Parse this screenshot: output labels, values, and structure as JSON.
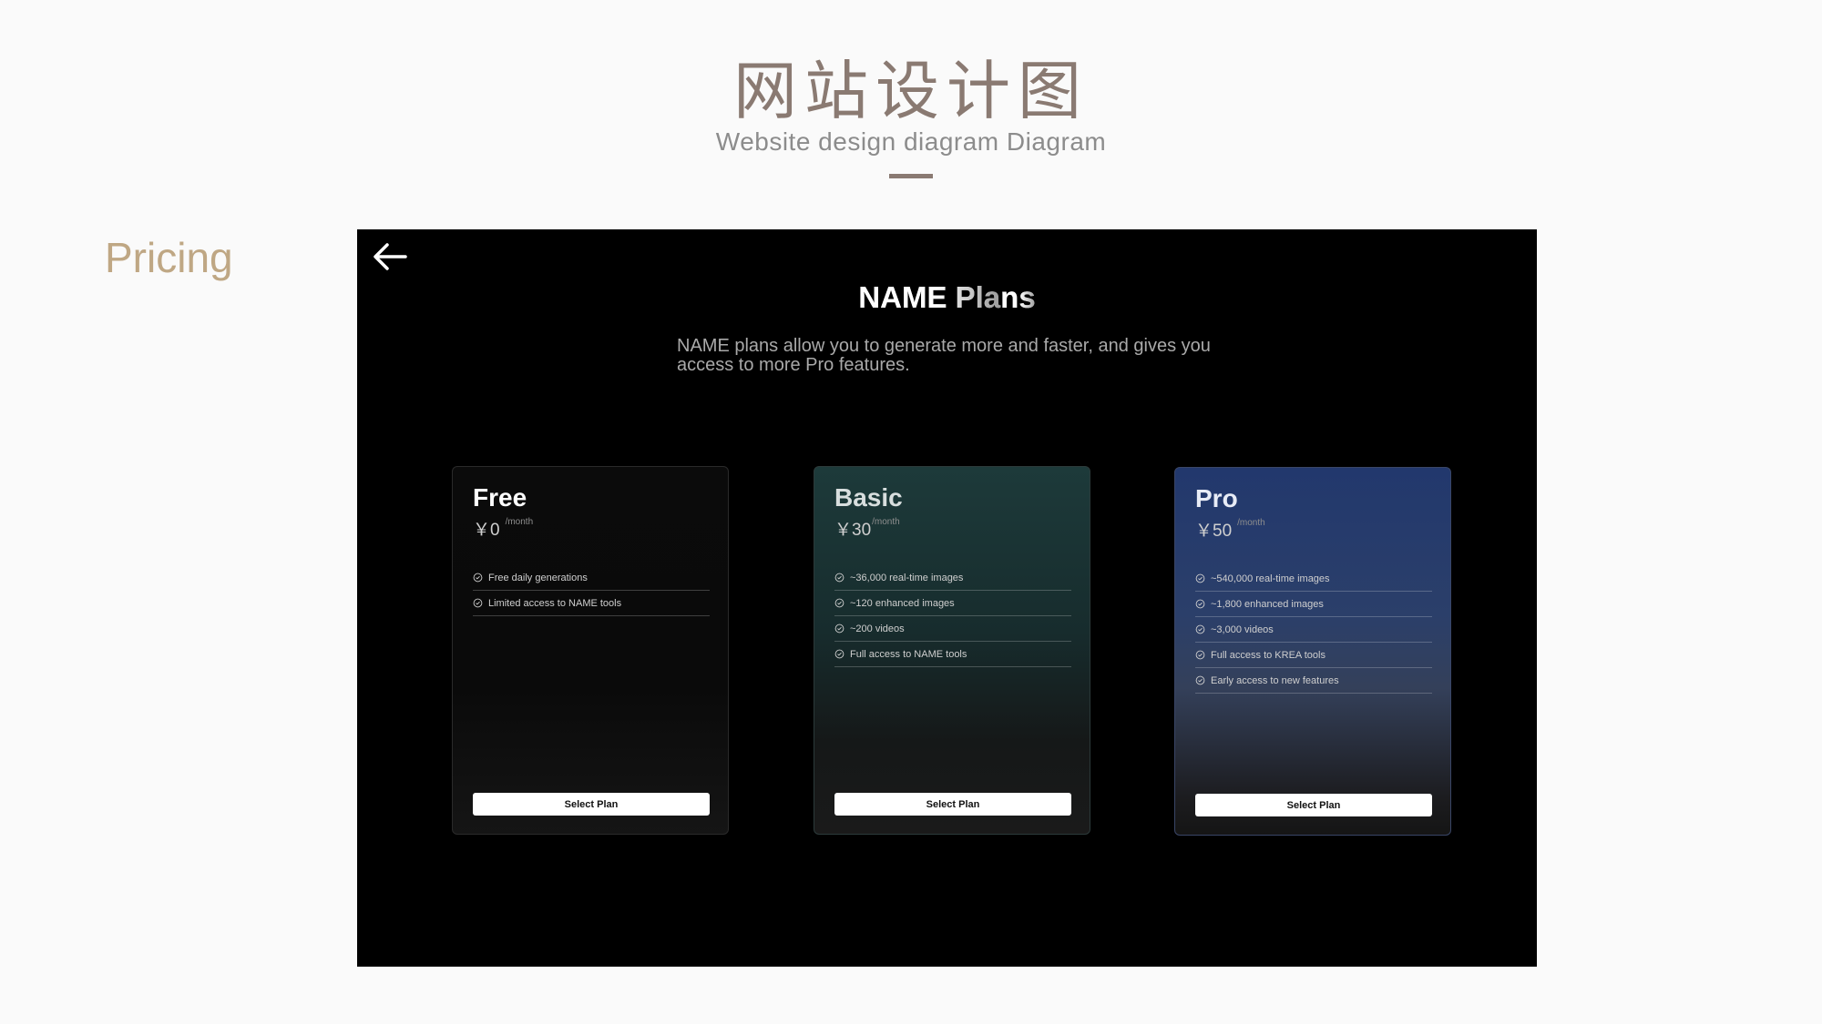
{
  "header": {
    "title": "网站设计图",
    "subtitle": "Website design diagram Diagram"
  },
  "section": {
    "label": "Pricing"
  },
  "screen": {
    "back_icon": "arrow-left-icon",
    "title_main": "NAME Pla",
    "title_fade": "ns",
    "description": "NAME plans allow you to generate more and faster, and gives you access to more Pro features."
  },
  "plans": [
    {
      "name": "Free",
      "price": "￥0",
      "period": "/month",
      "features": [
        "Free daily generations",
        "Limited access to NAME tools"
      ],
      "button": "Select Plan"
    },
    {
      "name": "Basic",
      "price": "￥30",
      "period": "/month",
      "features": [
        "~36,000 real-time images",
        "~120 enhanced images",
        "~200 videos",
        "Full access to NAME tools"
      ],
      "button": "Select Plan"
    },
    {
      "name": "Pro",
      "price": "￥50",
      "period": "/month",
      "features": [
        "~540,000 real-time images",
        "~1,800 enhanced images",
        "~3,000 videos",
        "Full access to KREA tools",
        "Early access to new features"
      ],
      "button": "Select Plan"
    }
  ],
  "colors": {
    "title": "#8a7a72",
    "section_label": "#bfa784",
    "screen_bg": "#000000",
    "button_bg": "#ffffff"
  }
}
